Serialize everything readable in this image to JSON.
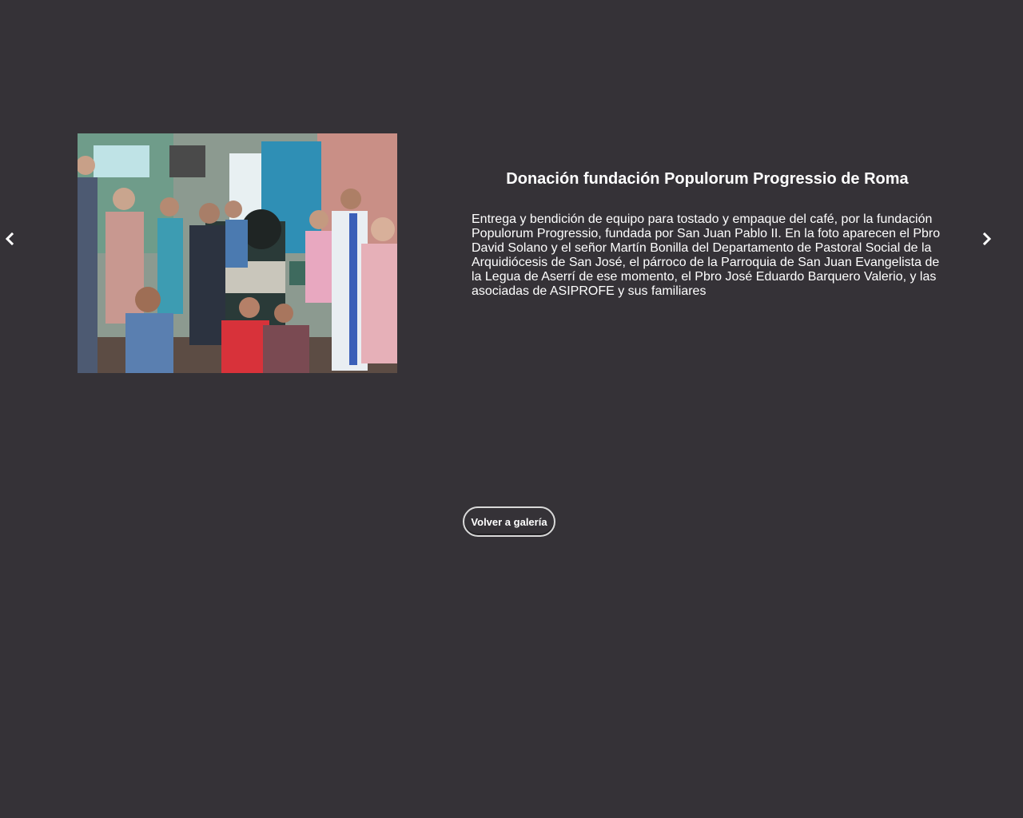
{
  "gallery": {
    "title": "Donación fundación Populorum Progressio de Roma",
    "description": "Entrega y bendición de equipo para tostado y empaque del café, por la fundación Populorum Progressio, fundada por San Juan Pablo II. En la foto aparecen el Pbro David Solano y el señor Martín Bonilla del Departamento de Pastoral Social de la Arquidiócesis de San José, el párroco de la Parroquia de San Juan Evangelista de la Legua de Aserrí de ese momento, el Pbro José Eduardo Barquero Valerio, y las asociadas de ASIPROFE y sus familiares",
    "back_label": "Volver a galería"
  },
  "icons": {
    "prev": "chevron-left-icon",
    "next": "chevron-right-icon"
  },
  "colors": {
    "background": "#353237",
    "text": "#ffffff",
    "button_border": "#d9d9d9"
  }
}
